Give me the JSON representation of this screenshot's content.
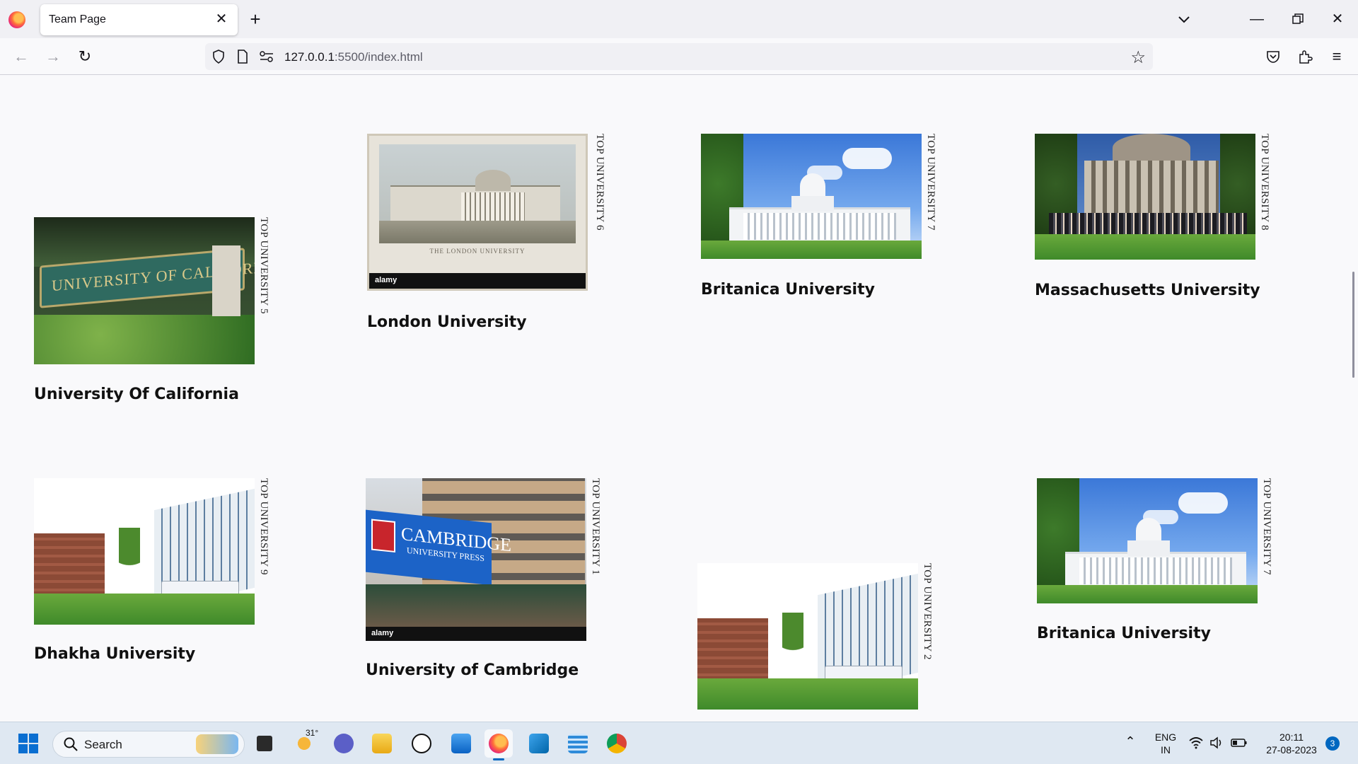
{
  "browser": {
    "tab_title": "Team Page",
    "url_host": "127.0.0.1",
    "url_rest": ":5500/index.html"
  },
  "cards": [
    {
      "label": "TOP UNIVERSITY 5",
      "title": "University Of California"
    },
    {
      "label": "TOP UNIVERSITY 6",
      "title": "London University"
    },
    {
      "label": "TOP UNIVERSITY 7",
      "title": "Britanica University"
    },
    {
      "label": "TOP UNIVERSITY 8",
      "title": "Massachusetts University"
    },
    {
      "label": "TOP UNIVERSITY 9",
      "title": "Dhakha University"
    },
    {
      "label": "TOP UNIVERSITY 1",
      "title": "University of Cambridge"
    },
    {
      "label": "TOP UNIVERSITY 2",
      "title": ""
    },
    {
      "label": "TOP UNIVERSITY 7",
      "title": "Britanica University"
    }
  ],
  "image_text": {
    "california_sign": "UNIVERSITY OF CALIFORNIA",
    "cambridge_sign": "CAMBRIDGE",
    "cambridge_sub": "UNIVERSITY PRESS",
    "watermark": "alamy",
    "london_caption": "THE LONDON UNIVERSITY"
  },
  "taskbar": {
    "search_label": "Search",
    "weather_temp": "31°",
    "lang_line1": "ENG",
    "lang_line2": "IN",
    "time": "20:11",
    "date": "27-08-2023",
    "notification_count": "3"
  },
  "colors": {
    "accent": "#0060df",
    "notification_badge": "#0067c0"
  }
}
